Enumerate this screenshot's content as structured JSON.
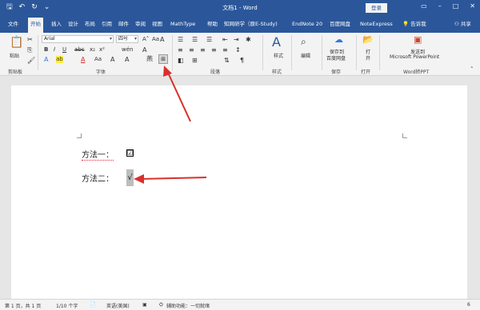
{
  "window": {
    "title": "文档1 - Word",
    "login_label": "登录"
  },
  "tabs": [
    {
      "label": "文件"
    },
    {
      "label": "开始"
    },
    {
      "label": "插入"
    },
    {
      "label": "设计"
    },
    {
      "label": "布局"
    },
    {
      "label": "引用"
    },
    {
      "label": "邮件"
    },
    {
      "label": "审阅"
    },
    {
      "label": "视图"
    },
    {
      "label": "MathType"
    },
    {
      "label": "帮助"
    },
    {
      "label": "知网研学（原E-Study)"
    },
    {
      "label": "EndNote 20"
    },
    {
      "label": "百度网盘"
    },
    {
      "label": "NoteExpress"
    }
  ],
  "tell_me": "告诉我",
  "share": "共享",
  "ribbon": {
    "clipboard": {
      "paste_label": "粘贴",
      "group_label": "剪贴板"
    },
    "font": {
      "font_name": "Arial",
      "font_size": "四号",
      "group_label": "字体"
    },
    "paragraph": {
      "group_label": "段落"
    },
    "styles": {
      "button_label": "样式",
      "group_label": "样式"
    },
    "editing": {
      "button_label": "编辑"
    },
    "save": {
      "button_label_1": "保存到",
      "button_label_2": "百度网盘",
      "group_label": "保存"
    },
    "open": {
      "button_label_1": "打",
      "button_label_2": "开",
      "group_label": "打开"
    },
    "ppt": {
      "button_label_1": "发送到",
      "button_label_2": "Microsoft PowerPoint",
      "group_label": "Word转PPT"
    }
  },
  "document": {
    "line1_label": "方法一：",
    "line1_symbol": "☑",
    "line2_label": "方法二：",
    "line2_symbol": "√"
  },
  "status": {
    "page": "第 1 页，共 1 页",
    "words": "1/10 个字",
    "language": "英语(美国)",
    "accessibility": "辅助功能：一切就绪",
    "zoom": "6"
  },
  "colors": {
    "title_bar": "#2b579a",
    "ribbon_bg": "#f3f3f3",
    "arrow": "#d9302b"
  }
}
